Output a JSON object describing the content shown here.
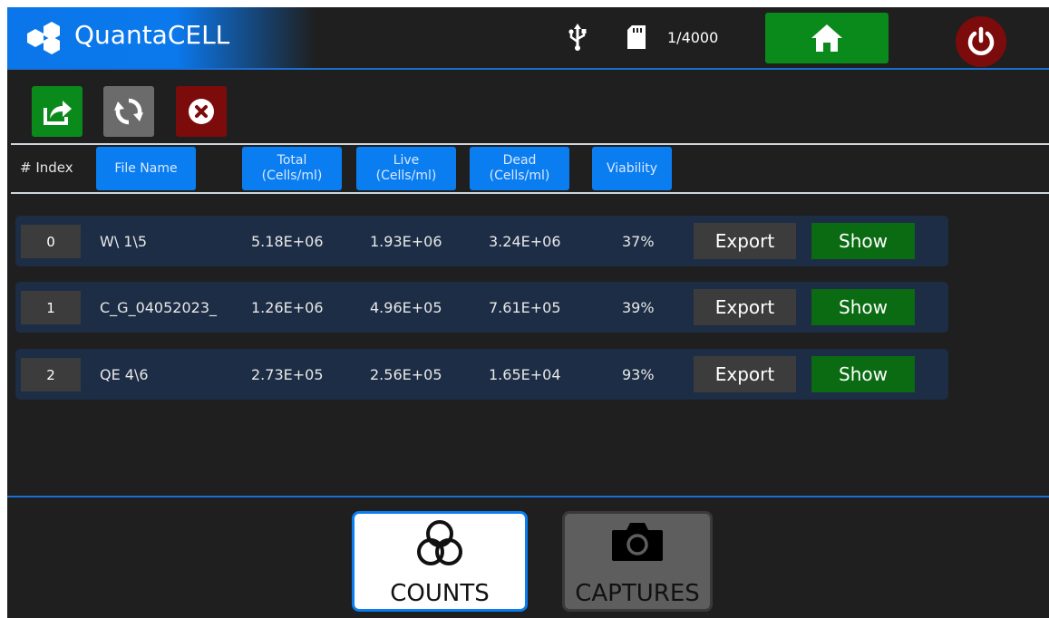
{
  "app": {
    "title": "QuantaCELL"
  },
  "status": {
    "counter": "1/4000",
    "icons": [
      "usb-icon",
      "sd-card-icon"
    ]
  },
  "header_buttons": [
    "home-icon",
    "power-icon"
  ],
  "toolbar": {
    "icons": [
      "export-icon",
      "refresh-icon",
      "delete-icon"
    ]
  },
  "columns": {
    "index": "# Index",
    "file_name": "File Name",
    "total": [
      "Total",
      "(Cells/ml)"
    ],
    "live": [
      "Live",
      "(Cells/ml)"
    ],
    "dead": [
      "Dead",
      "(Cells/ml)"
    ],
    "viability": "Viability"
  },
  "rows": [
    {
      "index": "0",
      "file": "W\\ 1\\5",
      "total": "5.18E+06",
      "live": "1.93E+06",
      "dead": "3.24E+06",
      "viability": "37%",
      "export_label": "Export",
      "show_label": "Show"
    },
    {
      "index": "1",
      "file": "C_G_04052023_",
      "total": "1.26E+06",
      "live": "4.96E+05",
      "dead": "7.61E+05",
      "viability": "39%",
      "export_label": "Export",
      "show_label": "Show"
    },
    {
      "index": "2",
      "file": "QE 4\\6",
      "total": "2.73E+05",
      "live": "2.56E+05",
      "dead": "1.65E+04",
      "viability": "93%",
      "export_label": "Export",
      "show_label": "Show"
    }
  ],
  "tabs": [
    {
      "label": "COUNTS",
      "icon": "venn-icon",
      "active": true
    },
    {
      "label": "CAPTURES",
      "icon": "camera-icon",
      "active": false
    }
  ],
  "colors": {
    "accent": "#0a7ef0",
    "green": "#0b8a1c",
    "red": "#7c0b0b",
    "row_bg": "#1c2d45",
    "background": "#1f1f1f"
  }
}
